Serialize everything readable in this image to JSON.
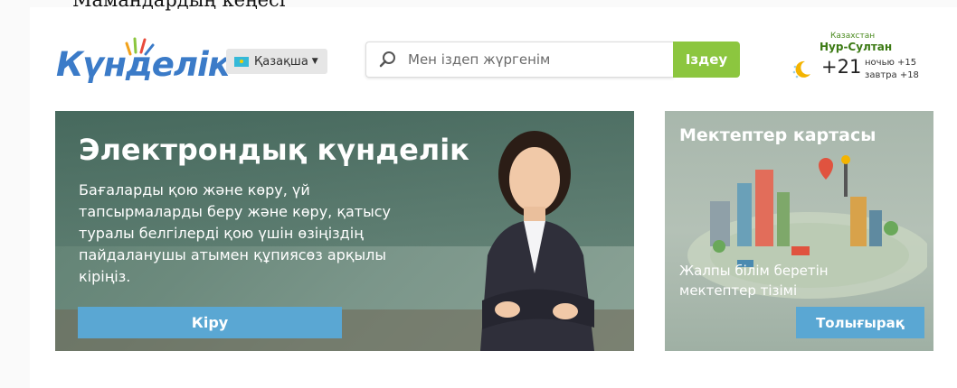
{
  "top_caption": "Мамандардың кеңесі",
  "header": {
    "logo_text": "Күнделік",
    "language_label": "Қазақша",
    "search": {
      "placeholder": "Мен іздеп жүргенім",
      "button_label": "Іздеу"
    },
    "weather": {
      "country": "Казахстан",
      "city": "Нур-Султан",
      "temperature": "+21",
      "night": "ночью +15",
      "tomorrow": "завтра +18"
    }
  },
  "main_banner": {
    "title": "Электрондық күнделік",
    "text": "Бағаларды қою және көру, үй тапсырмаларды беру және көру, қатысу туралы белгілерді қою үшін өзіңіздің пайдаланушы атымен құпиясөз арқылы кіріңіз.",
    "button_label": "Кіру"
  },
  "map_card": {
    "title": "Мектептер картасы",
    "text": "Жалпы білім беретін мектептер тізімі",
    "button_label": "Толығырақ"
  },
  "colors": {
    "brand_blue": "#3b7bc8",
    "accent_green": "#8cc63f",
    "button_blue": "#5aa7d3"
  }
}
